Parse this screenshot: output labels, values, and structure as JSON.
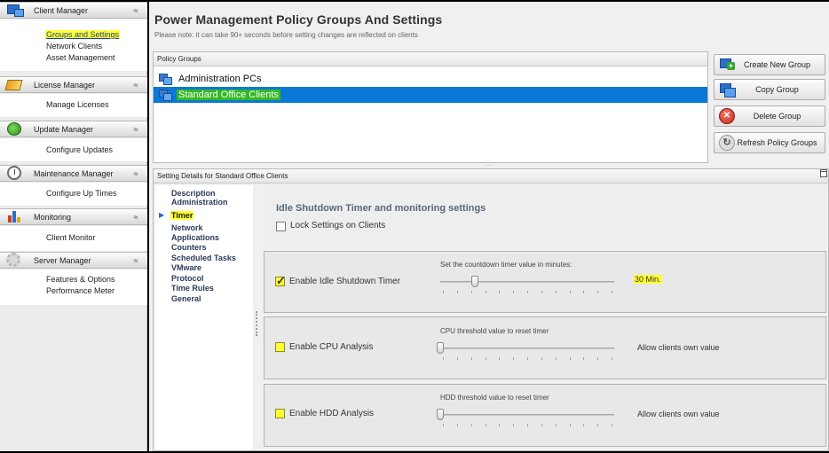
{
  "sidebar": {
    "sections": [
      {
        "title": "Client Manager",
        "items": [
          "Groups and Settings",
          "Network Clients",
          "Asset Management"
        ]
      },
      {
        "title": "License Manager",
        "items": [
          "Manage Licenses"
        ]
      },
      {
        "title": "Update  Manager",
        "items": [
          "Configure Updates"
        ]
      },
      {
        "title": "Maintenance Manager",
        "items": [
          "Configure Up Times"
        ]
      },
      {
        "title": "Monitoring",
        "items": [
          "Client Monitor"
        ]
      },
      {
        "title": "Server Manager",
        "items": [
          "Features & Options",
          "Performance Meter"
        ]
      }
    ],
    "collapse_glyph": "≈"
  },
  "main": {
    "title": "Power Management Policy Groups And Settings",
    "note": "Please note: it can take 90+ seconds before setting changes are reflected on clients",
    "groups": {
      "header": "Policy Groups",
      "items": [
        "Administration PCs",
        "Standard Office Clients"
      ],
      "selected": "Standard Office Clients"
    },
    "actions": {
      "create": "Create New Group",
      "copy": "Copy  Group",
      "delete": "Delete Group",
      "refresh": "Refresh Policy Groups"
    },
    "details": {
      "header": "Setting Details for Standard Office Clients",
      "nav": [
        "Description",
        "Administration",
        "Timer",
        "Network",
        "Applications",
        "Counters",
        "Scheduled Tasks",
        "VMware",
        "Protocol",
        "Time Rules",
        "General"
      ],
      "active_nav": "Timer",
      "section_title": "Idle Shutdown Timer and monitoring settings",
      "lock_label": "Lock Settings on Clients",
      "idle": {
        "label": "Enable Idle Shutdown Timer",
        "checked": true,
        "slider_caption": "Set the countdown timer value in minutes:",
        "value": "30 Min.",
        "level": 0.2
      },
      "cpu": {
        "label": "Enable CPU Analysis",
        "checked": false,
        "slider_caption": "CPU threshold value to reset timer",
        "value": "Allow clients own value",
        "level": 0
      },
      "hdd": {
        "label": "Enable HDD Analysis",
        "checked": false,
        "slider_caption": "HDD threshold value to reset timer",
        "value": "Allow clients own value",
        "level": 0
      }
    }
  },
  "colors": {
    "selection": "#0a78d7",
    "highlight": "#ffff33",
    "selected_label": "#33b823"
  }
}
